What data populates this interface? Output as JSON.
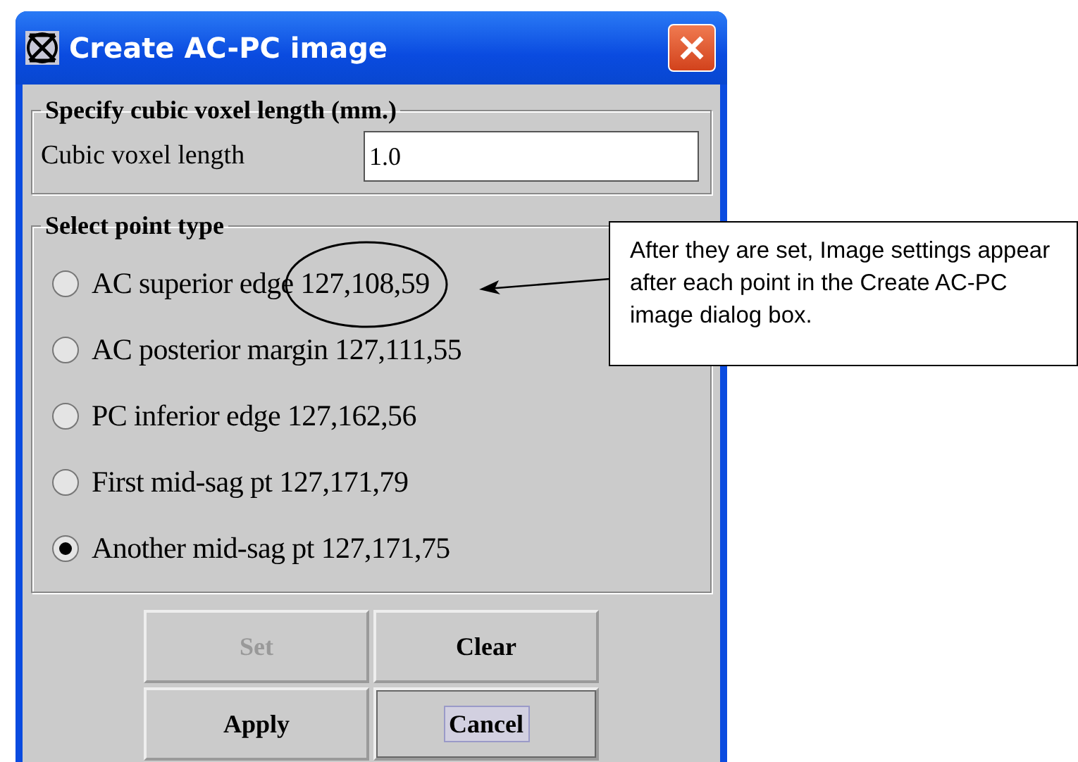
{
  "window": {
    "title": "Create AC-PC image"
  },
  "voxel_group": {
    "title": "Specify cubic voxel length (mm.)",
    "field_label": "Cubic voxel length",
    "field_value": "1.0"
  },
  "point_group": {
    "title": "Select point type",
    "points": [
      {
        "label": "AC superior edge 127,108,59",
        "selected": false,
        "circled": true
      },
      {
        "label": "AC posterior margin 127,111,55",
        "selected": false,
        "circled": false
      },
      {
        "label": "PC inferior edge 127,162,56",
        "selected": false,
        "circled": false
      },
      {
        "label": "First mid-sag pt 127,171,79",
        "selected": false,
        "circled": false
      },
      {
        "label": "Another mid-sag pt 127,171,75",
        "selected": true,
        "circled": false
      }
    ]
  },
  "buttons": [
    {
      "label": "Set",
      "disabled": true,
      "focused": false
    },
    {
      "label": "Clear",
      "disabled": false,
      "focused": false
    },
    {
      "label": "Apply",
      "disabled": false,
      "focused": false
    },
    {
      "label": "Cancel",
      "disabled": false,
      "focused": true
    }
  ],
  "callout": {
    "text": "After they are set, Image settings appear after each point in the Create AC-PC image dialog box."
  }
}
